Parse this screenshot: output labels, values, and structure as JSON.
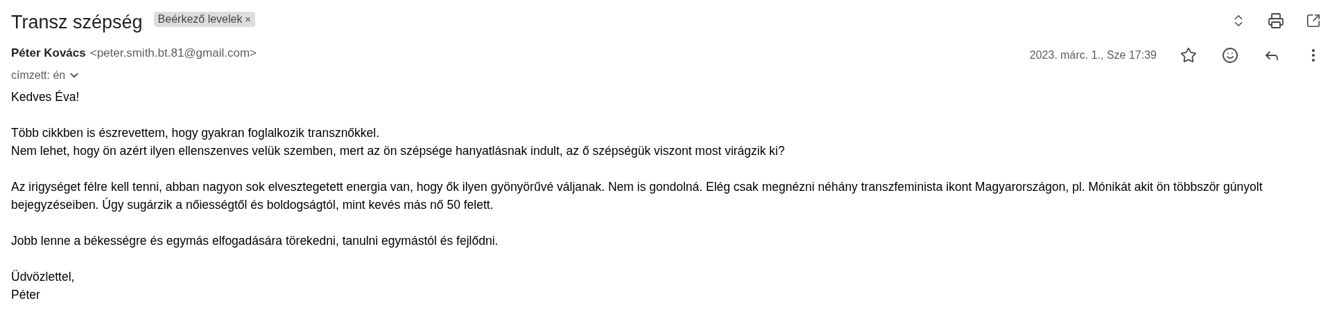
{
  "subject": "Transz szépség",
  "label": {
    "text": "Beérkező levelek",
    "remove": "×"
  },
  "sender": {
    "name": "Péter Kovács",
    "email": "<peter.smith.bt.81@gmail.com>"
  },
  "recipient": "címzett: én",
  "date": "2023. márc. 1., Sze 17:39",
  "starred": false,
  "body": [
    [
      "Kedves Éva!"
    ],
    [
      "Több cikkben is észrevettem, hogy gyakran foglalkozik transznőkkel.",
      "Nem lehet, hogy ön azért ilyen ellenszenves velük szemben, mert az ön szépsége hanyatlásnak indult, az ő szépségük viszont most virágzik ki?"
    ],
    [
      "Az irigységet félre kell tenni, abban nagyon sok elvesztegetett energia van, hogy ők ilyen gyönyörűvé váljanak. Nem is gondolná. Elég csak megnézni néhány transzfeminista ikont Magyarországon, pl. Mónikát akit ön többször gúnyolt bejegyzéseiben. Úgy sugárzik a nőiességtől és boldogságtól, mint kevés más nő 50 felett."
    ],
    [
      "Jobb lenne a békességre és egymás elfogadására törekedni, tanulni egymástól és fejlődni."
    ],
    [
      "Üdvözlettel,",
      "Péter"
    ]
  ]
}
